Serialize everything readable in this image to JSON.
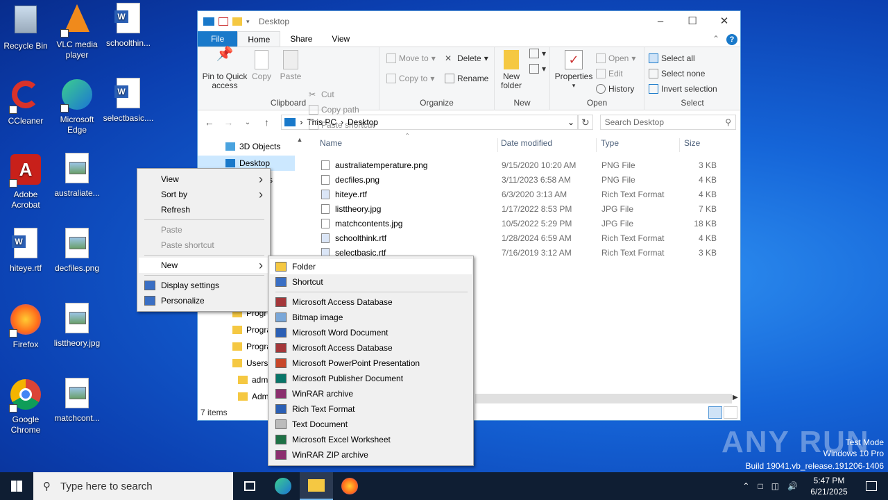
{
  "desktop_icons": [
    {
      "label": "Recycle Bin",
      "icon": "recycle-bin-icon"
    },
    {
      "label": "VLC media player",
      "icon": "vlc-icon"
    },
    {
      "label": "schoolthin...",
      "icon": "word-doc-icon"
    },
    {
      "label": "CCleaner",
      "icon": "ccleaner-icon"
    },
    {
      "label": "Microsoft Edge",
      "icon": "edge-icon"
    },
    {
      "label": "selectbasic....",
      "icon": "word-doc-icon"
    },
    {
      "label": "Adobe Acrobat",
      "icon": "acrobat-icon"
    },
    {
      "label": "australiate...",
      "icon": "image-file-icon"
    },
    {
      "label": "hiteye.rtf",
      "icon": "word-doc-icon"
    },
    {
      "label": "decfiles.png",
      "icon": "image-file-icon"
    },
    {
      "label": "Firefox",
      "icon": "firefox-icon"
    },
    {
      "label": "listtheory.jpg",
      "icon": "image-file-icon"
    },
    {
      "label": "Google Chrome",
      "icon": "chrome-icon"
    },
    {
      "label": "matchcont...",
      "icon": "image-file-icon"
    }
  ],
  "explorer": {
    "title": "Desktop",
    "tabs": [
      "File",
      "Home",
      "Share",
      "View"
    ],
    "ribbon": {
      "clipboard": {
        "label": "Clipboard",
        "pin": "Pin to Quick access",
        "copy": "Copy",
        "paste": "Paste",
        "cut": "Cut",
        "copy_path": "Copy path",
        "paste_shortcut": "Paste shortcut"
      },
      "organize": {
        "label": "Organize",
        "move_to": "Move to",
        "copy_to": "Copy to",
        "delete": "Delete",
        "rename": "Rename"
      },
      "new": {
        "label": "New",
        "new_folder": "New folder"
      },
      "open": {
        "label": "Open",
        "properties": "Properties",
        "open": "Open",
        "edit": "Edit",
        "history": "History"
      },
      "select": {
        "label": "Select",
        "select_all": "Select all",
        "select_none": "Select none",
        "invert": "Invert selection"
      }
    },
    "address": {
      "crumbs": [
        "This PC",
        "Desktop"
      ],
      "search_placeholder": "Search Desktop"
    },
    "nav_items": [
      "3D Objects",
      "Desktop",
      "nts",
      "ds",
      "Progr",
      "Progra",
      "Progra",
      "Users",
      "adm",
      "Adm"
    ],
    "columns": [
      "Name",
      "Date modified",
      "Type",
      "Size"
    ],
    "files": [
      {
        "name": "australiatemperature.png",
        "date": "9/15/2020 10:20 AM",
        "type": "PNG File",
        "size": "3 KB",
        "kind": "img"
      },
      {
        "name": "decfiles.png",
        "date": "3/11/2023 6:58 AM",
        "type": "PNG File",
        "size": "4 KB",
        "kind": "img"
      },
      {
        "name": "hiteye.rtf",
        "date": "6/3/2020 3:13 AM",
        "type": "Rich Text Format",
        "size": "4 KB",
        "kind": "doc"
      },
      {
        "name": "listtheory.jpg",
        "date": "1/17/2022 8:53 PM",
        "type": "JPG File",
        "size": "7 KB",
        "kind": "img"
      },
      {
        "name": "matchcontents.jpg",
        "date": "10/5/2022 5:29 PM",
        "type": "JPG File",
        "size": "18 KB",
        "kind": "img"
      },
      {
        "name": "schoolthink.rtf",
        "date": "1/28/2024 6:59 AM",
        "type": "Rich Text Format",
        "size": "4 KB",
        "kind": "doc"
      },
      {
        "name": "selectbasic.rtf",
        "date": "7/16/2019 3:12 AM",
        "type": "Rich Text Format",
        "size": "3 KB",
        "kind": "doc"
      }
    ],
    "status": "7 items"
  },
  "context_menu": {
    "items": [
      {
        "label": "View",
        "sub": true
      },
      {
        "label": "Sort by",
        "sub": true
      },
      {
        "label": "Refresh"
      },
      {
        "sep": true
      },
      {
        "label": "Paste",
        "disabled": true
      },
      {
        "label": "Paste shortcut",
        "disabled": true
      },
      {
        "sep": true
      },
      {
        "label": "New",
        "sub": true,
        "highlight": true
      },
      {
        "sep": true
      },
      {
        "label": "Display settings",
        "icon": "display-icon"
      },
      {
        "label": "Personalize",
        "icon": "personalize-icon"
      }
    ]
  },
  "new_submenu": {
    "items": [
      {
        "label": "Folder",
        "icon": "folder-icon",
        "color": "#f5c842",
        "highlight": true
      },
      {
        "label": "Shortcut",
        "icon": "shortcut-icon",
        "color": "#3a6fc4"
      },
      {
        "sep": true
      },
      {
        "label": "Microsoft Access Database",
        "icon": "access-icon",
        "color": "#a4373a"
      },
      {
        "label": "Bitmap image",
        "icon": "bitmap-icon",
        "color": "#7aa7d8"
      },
      {
        "label": "Microsoft Word Document",
        "icon": "word-icon",
        "color": "#2b5fb4"
      },
      {
        "label": "Microsoft Access Database",
        "icon": "access-icon",
        "color": "#a4373a"
      },
      {
        "label": "Microsoft PowerPoint Presentation",
        "icon": "powerpoint-icon",
        "color": "#c8472a"
      },
      {
        "label": "Microsoft Publisher Document",
        "icon": "publisher-icon",
        "color": "#077568"
      },
      {
        "label": "WinRAR archive",
        "icon": "winrar-icon",
        "color": "#8b2f6e"
      },
      {
        "label": "Rich Text Format",
        "icon": "rtf-icon",
        "color": "#2b5fb4"
      },
      {
        "label": "Text Document",
        "icon": "text-doc-icon",
        "color": "#bbbbbb"
      },
      {
        "label": "Microsoft Excel Worksheet",
        "icon": "excel-icon",
        "color": "#1e7145"
      },
      {
        "label": "WinRAR ZIP archive",
        "icon": "winrar-zip-icon",
        "color": "#8b2f6e"
      }
    ]
  },
  "taskbar": {
    "search_placeholder": "Type here to search",
    "time": "5:47 PM",
    "date": "6/21/2025"
  },
  "watermark": {
    "brand": "ANY RUN",
    "line1": "Test Mode",
    "line2": "Windows 10 Pro",
    "line3": "Build 19041.vb_release.191206-1406"
  },
  "colors": {
    "accent": "#1979ca",
    "menu_bg": "#f0f0f0",
    "taskbar": "#0f1e33"
  }
}
